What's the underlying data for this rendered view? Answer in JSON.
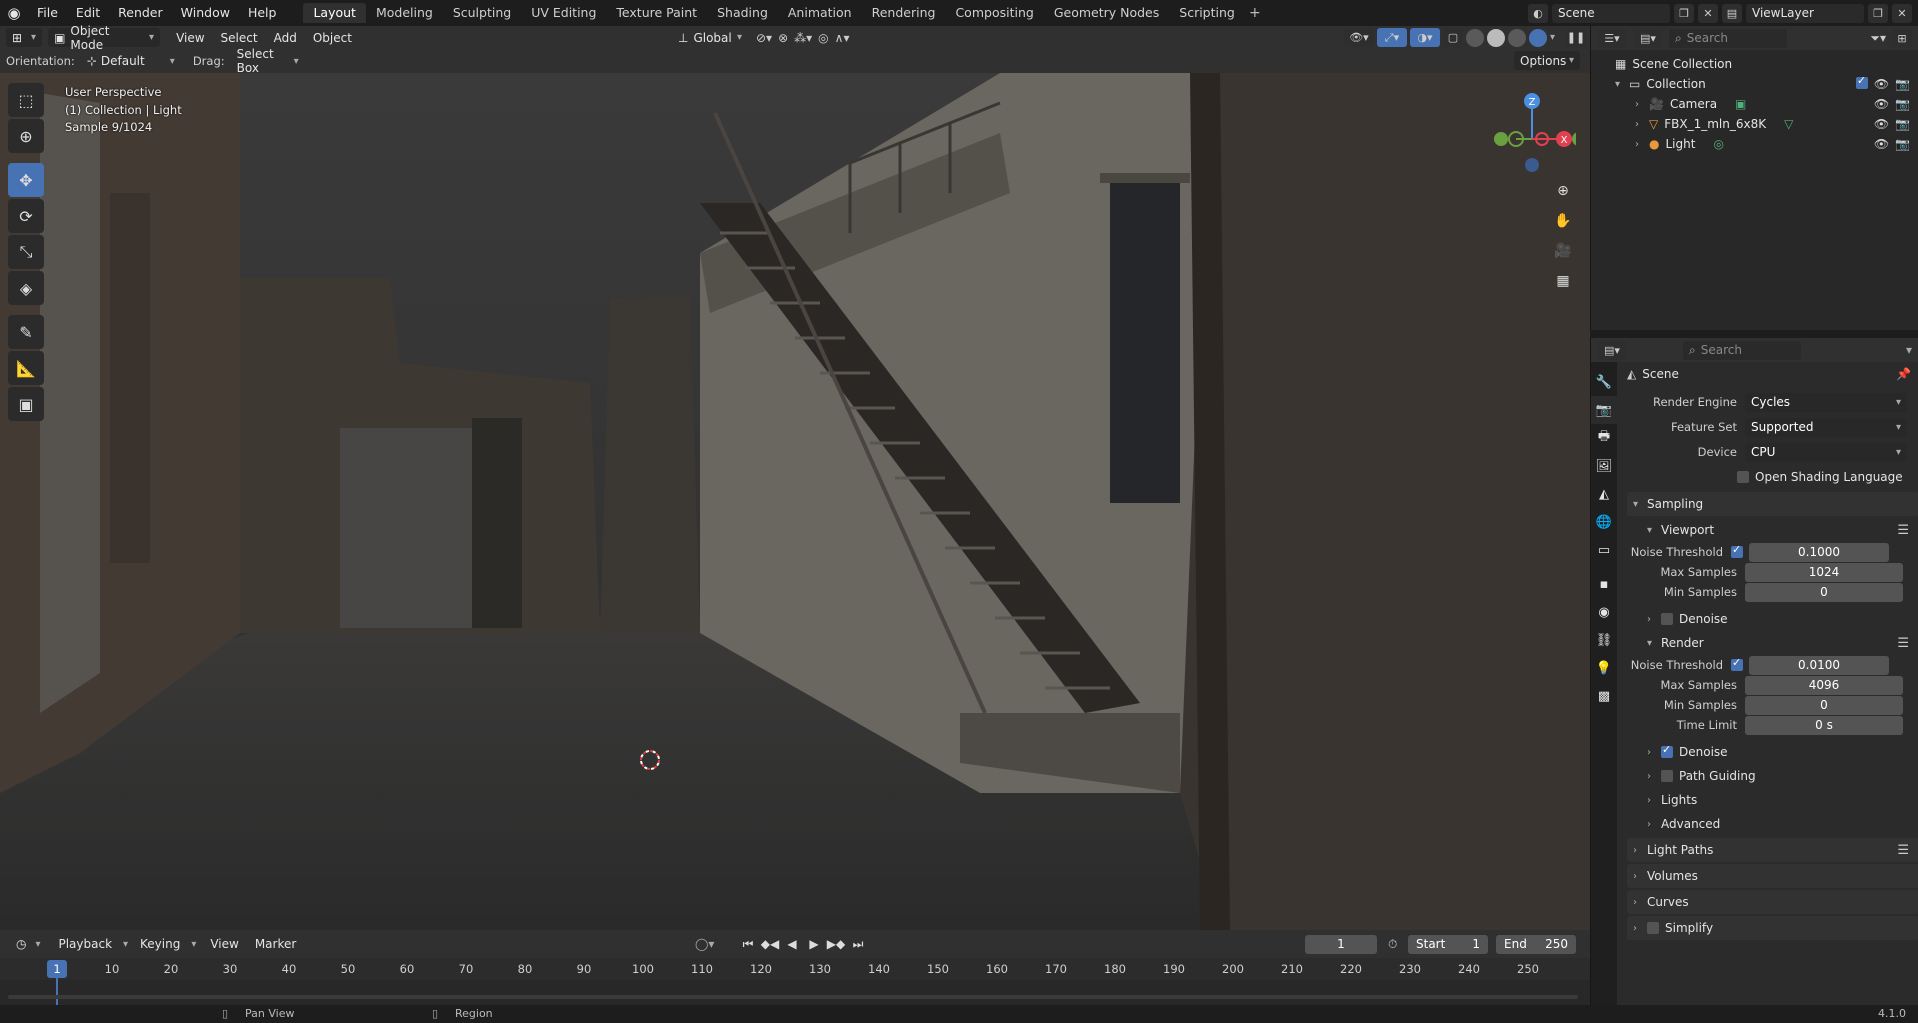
{
  "topbar": {
    "menus": [
      "File",
      "Edit",
      "Render",
      "Window",
      "Help"
    ],
    "workspaces": [
      "Layout",
      "Modeling",
      "Sculpting",
      "UV Editing",
      "Texture Paint",
      "Shading",
      "Animation",
      "Rendering",
      "Compositing",
      "Geometry Nodes",
      "Scripting"
    ],
    "active_workspace": "Layout",
    "scene": "Scene",
    "view_layer": "ViewLayer"
  },
  "viewport_header": {
    "mode": "Object Mode",
    "menus": [
      "View",
      "Select",
      "Add",
      "Object"
    ],
    "orientation_label": "Orientation:",
    "orientation_value": "Default",
    "drag_label": "Drag:",
    "drag_value": "Select Box",
    "transform": "Global",
    "options": "Options"
  },
  "viewport_overlay": {
    "line1": "User Perspective",
    "line2": "(1) Collection | Light",
    "line3": "Sample 9/1024"
  },
  "gizmo": {
    "z": "Z",
    "y": "Y",
    "x": "X"
  },
  "outliner": {
    "search_placeholder": "Search",
    "root": "Scene Collection",
    "collection": "Collection",
    "items": [
      "Camera",
      "FBX_1_mln_6x8K",
      "Light"
    ]
  },
  "properties": {
    "search_placeholder": "Search",
    "scene": "Scene",
    "render_engine_label": "Render Engine",
    "render_engine": "Cycles",
    "feature_set_label": "Feature Set",
    "feature_set": "Supported",
    "device_label": "Device",
    "device": "CPU",
    "osl": "Open Shading Language",
    "sampling": "Sampling",
    "viewport": "Viewport",
    "noise_threshold_label": "Noise Threshold",
    "vp_noise_threshold": "0.1000",
    "max_samples_label": "Max Samples",
    "vp_max_samples": "1024",
    "min_samples_label": "Min Samples",
    "vp_min_samples": "0",
    "denoise": "Denoise",
    "render": "Render",
    "r_noise_threshold": "0.0100",
    "r_max_samples": "4096",
    "r_min_samples": "0",
    "time_limit_label": "Time Limit",
    "r_time_limit": "0 s",
    "path_guiding": "Path Guiding",
    "lights": "Lights",
    "advanced": "Advanced",
    "light_paths": "Light Paths",
    "volumes": "Volumes",
    "curves": "Curves",
    "simplify": "Simplify"
  },
  "timeline": {
    "menus": [
      "Playback",
      "Keying",
      "View",
      "Marker"
    ],
    "current_frame": "1",
    "start_label": "Start",
    "start": "1",
    "end_label": "End",
    "end": "250",
    "ticks": [
      "10",
      "20",
      "30",
      "40",
      "50",
      "60",
      "70",
      "80",
      "90",
      "100",
      "110",
      "120",
      "130",
      "140",
      "150",
      "160",
      "170",
      "180",
      "190",
      "200",
      "210",
      "220",
      "230",
      "240",
      "250"
    ],
    "marker": "1"
  },
  "statusbar": {
    "pan_view": "Pan View",
    "region": "Region",
    "version": "4.1.0"
  },
  "colors": {
    "accent": "#4772b3",
    "panel": "#303030",
    "background": "#1d1d1d"
  }
}
